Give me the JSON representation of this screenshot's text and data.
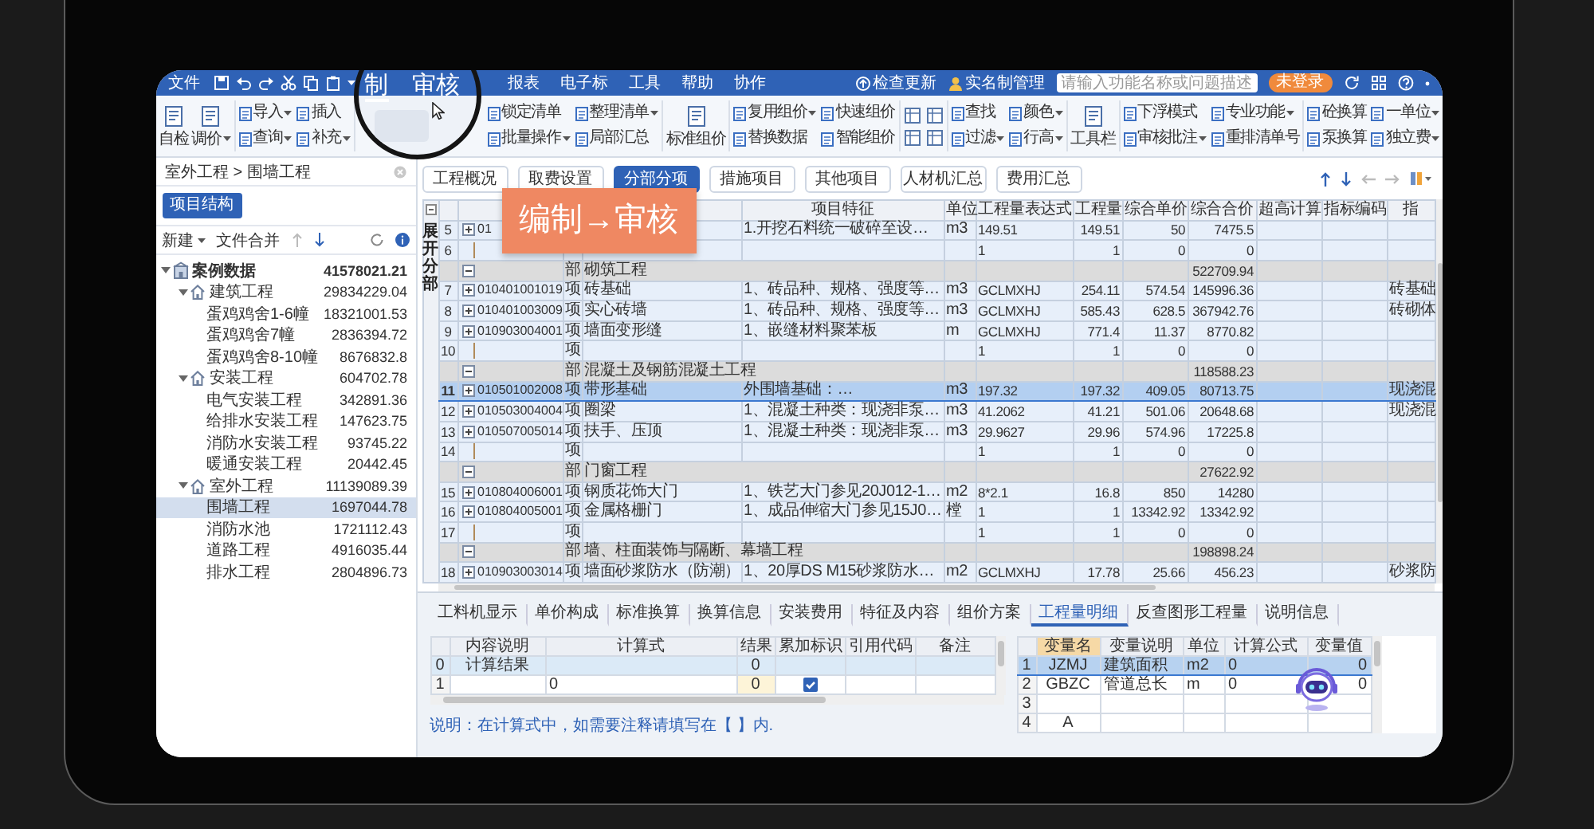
{
  "menu_bar": {
    "file_menu": "文件",
    "items": [
      "报表",
      "电子标",
      "工具",
      "帮助",
      "协作"
    ],
    "check_update": "检查更新",
    "real_name": "实名制管理",
    "search": {
      "placeholder": "请输入功能名称或问题描述"
    },
    "login_badge": "未登录"
  },
  "magnifier": {
    "items": [
      {
        "label": "制",
        "selected": true
      },
      {
        "label": "审核",
        "selected": false
      }
    ]
  },
  "ribbon": {
    "groups": [
      {
        "kind": "large",
        "items": [
          {
            "label": "自检",
            "dropdown": false
          },
          {
            "label": "调价",
            "dropdown": true
          }
        ]
      },
      {
        "kind": "small",
        "items": [
          {
            "label": "导入",
            "dropdown": true
          },
          {
            "label": "插入",
            "dropdown": false
          },
          {
            "label": "查询",
            "dropdown": true
          },
          {
            "label": "补充",
            "dropdown": true
          }
        ]
      },
      {
        "kind": "small",
        "items": [
          {
            "label": "锁定清单",
            "dropdown": false
          },
          {
            "label": "整理清单",
            "dropdown": true
          },
          {
            "label": "批量操作",
            "dropdown": true
          },
          {
            "label": "局部汇总",
            "dropdown": false
          }
        ]
      },
      {
        "kind": "large",
        "items": [
          {
            "label": "标准组价",
            "dropdown": false
          }
        ]
      },
      {
        "kind": "small",
        "items": [
          {
            "label": "复用组价",
            "dropdown": true
          },
          {
            "label": "快速组价",
            "dropdown": false
          },
          {
            "label": "替换数据",
            "dropdown": false
          },
          {
            "label": "智能组价",
            "dropdown": false
          }
        ]
      },
      {
        "kind": "icons"
      },
      {
        "kind": "small",
        "items": [
          {
            "label": "查找",
            "dropdown": false
          },
          {
            "label": "颜色",
            "dropdown": true
          },
          {
            "label": "过滤",
            "dropdown": true
          },
          {
            "label": "行高",
            "dropdown": true
          }
        ]
      },
      {
        "kind": "large",
        "items": [
          {
            "label": "工具栏",
            "dropdown": false
          }
        ]
      },
      {
        "kind": "small",
        "items": [
          {
            "label": "下浮模式",
            "dropdown": false
          },
          {
            "label": "专业功能",
            "dropdown": true
          },
          {
            "label": "审核批注",
            "dropdown": true
          },
          {
            "label": "重排清单号",
            "dropdown": false
          }
        ]
      },
      {
        "kind": "small",
        "items": [
          {
            "label": "砼换算",
            "dropdown": false
          },
          {
            "label": "一单位",
            "dropdown": true
          },
          {
            "label": "泵换算",
            "dropdown": false
          },
          {
            "label": "独立费",
            "dropdown": true
          }
        ]
      }
    ]
  },
  "project_panel": {
    "breadcrumb": "室外工程 > 围墙工程",
    "structure_button": "项目结构",
    "new_button": "新建",
    "merge_button": "文件合并",
    "tree": [
      {
        "label": "案例数据",
        "value": "41578021.21",
        "expanded": true,
        "selected": false,
        "children": [
          {
            "label": "建筑工程",
            "value": "29834229.04",
            "expanded": true,
            "selected": false,
            "children": [
              {
                "label": "蛋鸡鸡舍1-6幢",
                "value": "18321001.53",
                "selected": false
              },
              {
                "label": "蛋鸡鸡舍7幢",
                "value": "2836394.72",
                "selected": false
              },
              {
                "label": "蛋鸡鸡舍8-10幢",
                "value": "8676832.8",
                "selected": false
              }
            ]
          },
          {
            "label": "安装工程",
            "value": "604702.78",
            "expanded": true,
            "selected": false,
            "children": [
              {
                "label": "电气安装工程",
                "value": "342891.36",
                "selected": false
              },
              {
                "label": "给排水安装工程",
                "value": "147623.75",
                "selected": false
              },
              {
                "label": "消防水安装工程",
                "value": "93745.22",
                "selected": false
              },
              {
                "label": "暖通安装工程",
                "value": "20442.45",
                "selected": false
              }
            ]
          },
          {
            "label": "室外工程",
            "value": "11139089.39",
            "expanded": true,
            "selected": false,
            "children": [
              {
                "label": "围墙工程",
                "value": "1697044.78",
                "selected": true
              },
              {
                "label": "消防水池",
                "value": "1721112.43",
                "selected": false
              },
              {
                "label": "道路工程",
                "value": "4916035.44",
                "selected": false
              },
              {
                "label": "排水工程",
                "value": "2804896.73",
                "selected": false
              }
            ]
          }
        ]
      }
    ]
  },
  "tabs": [
    {
      "label": "工程概况",
      "selected": false
    },
    {
      "label": "取费设置",
      "selected": false
    },
    {
      "label": "分部分项",
      "selected": true
    },
    {
      "label": "措施项目",
      "selected": false
    },
    {
      "label": "其他项目",
      "selected": false
    },
    {
      "label": "人材机汇总",
      "selected": false
    },
    {
      "label": "费用汇总",
      "selected": false
    }
  ],
  "callout": "编制→审核",
  "bill_grid": {
    "side_label": "展开分部",
    "headers": [
      "项目特征",
      "单位",
      "工程量表达式",
      "工程量",
      "综合单价",
      "综合合价",
      "超高计算",
      "指标编码",
      "指"
    ],
    "rows": [
      {
        "kind": "item",
        "number": "5",
        "code": "01",
        "feature": "1.开挖石料统一破碎至设…",
        "unit": "m3",
        "expression": "149.51",
        "quantity": "149.51",
        "unit_price": "50",
        "total": "7475.5",
        "expanded": false,
        "selected": false
      },
      {
        "kind": "blank",
        "number": "6",
        "expression": "1",
        "quantity": "1",
        "unit_price": "0",
        "total": "0",
        "selected": false
      },
      {
        "kind": "section",
        "type": "部",
        "name": "砌筑工程",
        "total": "522709.94",
        "expanded": true,
        "selected": false
      },
      {
        "kind": "item",
        "number": "7",
        "code": "010401001019",
        "type": "项",
        "name": "砖基础",
        "feature": "1、砖品种、规格、强度等…",
        "unit": "m3",
        "expression": "GCLMXHJ",
        "quantity": "254.11",
        "unit_price": "574.54",
        "total": "145996.36",
        "column_13": "砖基础",
        "expanded": false,
        "selected": false
      },
      {
        "kind": "item",
        "number": "8",
        "code": "010401003009",
        "type": "项",
        "name": "实心砖墙",
        "feature": "1、砖品种、规格、强度等…",
        "unit": "m3",
        "expression": "GCLMXHJ",
        "quantity": "585.43",
        "unit_price": "628.5",
        "total": "367942.76",
        "column_13": "砖砌体",
        "expanded": false,
        "selected": false
      },
      {
        "kind": "item",
        "number": "9",
        "code": "010903004001",
        "type": "项",
        "name": "墙面变形缝",
        "feature": "1、嵌缝材料聚苯板",
        "unit": "m",
        "expression": "GCLMXHJ",
        "quantity": "771.4",
        "unit_price": "11.37",
        "total": "8770.82",
        "expanded": false,
        "selected": false
      },
      {
        "kind": "blank",
        "number": "10",
        "type": "项",
        "expression": "1",
        "quantity": "1",
        "unit_price": "0",
        "total": "0",
        "selected": false
      },
      {
        "kind": "section",
        "type": "部",
        "name": "混凝土及钢筋混凝土工程",
        "total": "118588.23",
        "expanded": true,
        "selected": false
      },
      {
        "kind": "item",
        "number": "11",
        "code": "010501002008",
        "type": "项",
        "name": "带形基础",
        "feature": "外围墙基础：…",
        "unit": "m3",
        "expression": "197.32",
        "quantity": "197.32",
        "unit_price": "409.05",
        "total": "80713.75",
        "column_13": "现浇混",
        "expanded": false,
        "selected": true
      },
      {
        "kind": "item",
        "number": "12",
        "code": "010503004004",
        "type": "项",
        "name": "圈梁",
        "feature": "1、混凝土种类：现浇非泵…",
        "unit": "m3",
        "expression": "41.2062",
        "quantity": "41.21",
        "unit_price": "501.06",
        "total": "20648.68",
        "column_13": "现浇混",
        "expanded": false,
        "selected": false
      },
      {
        "kind": "item",
        "number": "13",
        "code": "010507005014",
        "type": "项",
        "name": "扶手、压顶",
        "feature": "1、混凝土种类：现浇非泵…",
        "unit": "m3",
        "expression": "29.9627",
        "quantity": "29.96",
        "unit_price": "574.96",
        "total": "17225.8",
        "expanded": false,
        "selected": false
      },
      {
        "kind": "blank",
        "number": "14",
        "type": "项",
        "expression": "1",
        "quantity": "1",
        "unit_price": "0",
        "total": "0",
        "selected": false
      },
      {
        "kind": "section",
        "type": "部",
        "name": "门窗工程",
        "total": "27622.92",
        "expanded": true,
        "selected": false
      },
      {
        "kind": "item",
        "number": "15",
        "code": "010804006001",
        "type": "项",
        "name": "钢质花饰大门",
        "feature": "1、铁艺大门参见20J012-1…",
        "unit": "m2",
        "expression": "8*2.1",
        "quantity": "16.8",
        "unit_price": "850",
        "total": "14280",
        "expanded": false,
        "selected": false
      },
      {
        "kind": "item",
        "number": "16",
        "code": "010804005001",
        "type": "项",
        "name": "金属格栅门",
        "feature": "1、成品伸缩大门参见15J0…",
        "unit": "樘",
        "expression": "1",
        "quantity": "1",
        "unit_price": "13342.92",
        "total": "13342.92",
        "expanded": false,
        "selected": false
      },
      {
        "kind": "blank",
        "number": "17",
        "type": "项",
        "expression": "1",
        "quantity": "1",
        "unit_price": "0",
        "total": "0",
        "selected": false
      },
      {
        "kind": "section",
        "type": "部",
        "name": "墙、柱面装饰与隔断、幕墙工程",
        "total": "198898.24",
        "expanded": true,
        "selected": false
      },
      {
        "kind": "item",
        "number": "18",
        "code": "010903003014",
        "type": "项",
        "name": "墙面砂浆防水（防潮）",
        "feature": "1、20厚DS M15砂浆防水…",
        "unit": "m2",
        "expression": "GCLMXHJ",
        "quantity": "17.78",
        "unit_price": "25.66",
        "total": "456.23",
        "column_13": "砂浆防",
        "expanded": false,
        "selected": false
      }
    ]
  },
  "detail_panel": {
    "tabs": [
      {
        "label": "工料机显示",
        "selected": false
      },
      {
        "label": "单价构成",
        "selected": false
      },
      {
        "label": "标准换算",
        "selected": false
      },
      {
        "label": "换算信息",
        "selected": false
      },
      {
        "label": "安装费用",
        "selected": false
      },
      {
        "label": "特征及内容",
        "selected": false
      },
      {
        "label": "组价方案",
        "selected": false
      },
      {
        "label": "工程量明细",
        "selected": true
      },
      {
        "label": "反查图形工程量",
        "selected": false
      },
      {
        "label": "说明信息",
        "selected": false
      }
    ],
    "calc_table": {
      "headers": [
        "内容说明",
        "计算式",
        "结果",
        "累加标识",
        "引用代码",
        "备注"
      ],
      "rows": [
        {
          "kind": "total",
          "number": "0",
          "description": "计算结果",
          "result": "0",
          "selected": true
        },
        {
          "kind": "line",
          "number": "1",
          "formula": "0",
          "result": "0",
          "checked": true,
          "selected": false
        }
      ]
    },
    "note": "说明：在计算式中，如需要注释请填写在【 】内.",
    "variables_table": {
      "headers": [
        "变量名",
        "变量说明",
        "单位",
        "计算公式",
        "变量值"
      ],
      "rows": [
        {
          "number": "1",
          "name": "JZMJ",
          "description": "建筑面积",
          "unit": "m2",
          "formula": "0",
          "value": "0",
          "selected": true
        },
        {
          "number": "2",
          "name": "GBZC",
          "description": "管道总长",
          "unit": "m",
          "formula": "0",
          "value": "0",
          "selected": false
        },
        {
          "number": "3",
          "selected": false
        },
        {
          "number": "4",
          "name": "A",
          "selected": false
        }
      ]
    }
  }
}
